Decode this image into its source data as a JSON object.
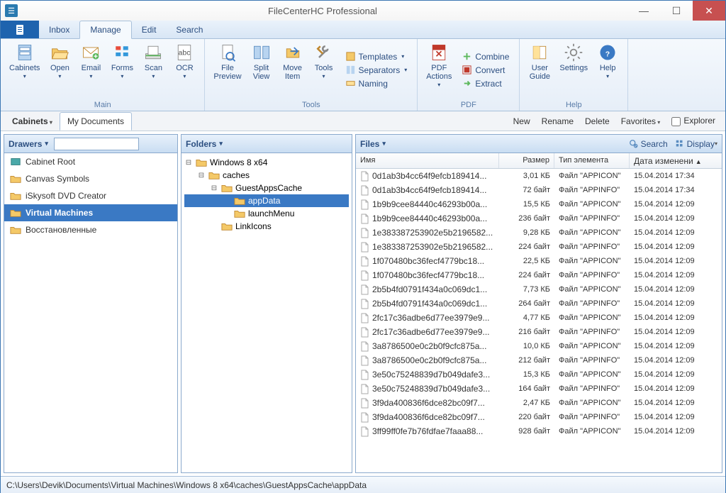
{
  "title": "FileCenterHC Professional",
  "tabs": {
    "inbox": "Inbox",
    "manage": "Manage",
    "edit": "Edit",
    "search": "Search"
  },
  "ribbon": {
    "main": {
      "label": "Main",
      "cabinets": "Cabinets",
      "open": "Open",
      "email": "Email",
      "forms": "Forms",
      "scan": "Scan",
      "ocr": "OCR"
    },
    "tools": {
      "label": "Tools",
      "filePreview": "File\nPreview",
      "splitView": "Split\nView",
      "moveItem": "Move\nItem",
      "tools": "Tools",
      "templates": "Templates",
      "separators": "Separators",
      "naming": "Naming"
    },
    "pdf": {
      "label": "PDF",
      "pdfActions": "PDF\nActions",
      "combine": "Combine",
      "convert": "Convert",
      "extract": "Extract"
    },
    "help": {
      "label": "Help",
      "userGuide": "User\nGuide",
      "settings": "Settings",
      "help": "Help"
    }
  },
  "cabbar": {
    "cabinets": "Cabinets",
    "mydocs": "My Documents",
    "new": "New",
    "rename": "Rename",
    "delete": "Delete",
    "favorites": "Favorites",
    "explorer": "Explorer"
  },
  "drawers": {
    "header": "Drawers",
    "items": [
      {
        "label": "Cabinet Root",
        "type": "folder-teal"
      },
      {
        "label": "Canvas Symbols",
        "type": "folder"
      },
      {
        "label": "iSkysoft DVD Creator",
        "type": "folder"
      },
      {
        "label": "Virtual Machines",
        "type": "folder",
        "sel": true
      },
      {
        "label": "Восстановленные",
        "type": "folder"
      }
    ]
  },
  "folders": {
    "header": "Folders",
    "tree": [
      {
        "depth": 0,
        "tog": "-",
        "label": "Windows 8 x64"
      },
      {
        "depth": 1,
        "tog": "-",
        "label": "caches"
      },
      {
        "depth": 2,
        "tog": "-",
        "label": "GuestAppsCache"
      },
      {
        "depth": 3,
        "tog": "",
        "label": "appData",
        "sel": true
      },
      {
        "depth": 3,
        "tog": "",
        "label": "launchMenu"
      },
      {
        "depth": 2,
        "tog": "",
        "label": "LinkIcons"
      }
    ]
  },
  "files": {
    "header": "Files",
    "search": "Search",
    "display": "Display",
    "cols": {
      "name": "Имя",
      "size": "Размер",
      "type": "Тип элемента",
      "date": "Дата изменени"
    },
    "rows": [
      {
        "name": "0d1ab3b4cc64f9efcb189414...",
        "size": "3,01 КБ",
        "type": "Файл \"APPICON\"",
        "date": "15.04.2014 17:34"
      },
      {
        "name": "0d1ab3b4cc64f9efcb189414...",
        "size": "72 байт",
        "type": "Файл \"APPINFO\"",
        "date": "15.04.2014 17:34"
      },
      {
        "name": "1b9b9cee84440c46293b00a...",
        "size": "15,5 КБ",
        "type": "Файл \"APPICON\"",
        "date": "15.04.2014 12:09"
      },
      {
        "name": "1b9b9cee84440c46293b00a...",
        "size": "236 байт",
        "type": "Файл \"APPINFO\"",
        "date": "15.04.2014 12:09"
      },
      {
        "name": "1e383387253902e5b2196582...",
        "size": "9,28 КБ",
        "type": "Файл \"APPICON\"",
        "date": "15.04.2014 12:09"
      },
      {
        "name": "1e383387253902e5b2196582...",
        "size": "224 байт",
        "type": "Файл \"APPINFO\"",
        "date": "15.04.2014 12:09"
      },
      {
        "name": "1f070480bc36fecf4779bc18...",
        "size": "22,5 КБ",
        "type": "Файл \"APPICON\"",
        "date": "15.04.2014 12:09"
      },
      {
        "name": "1f070480bc36fecf4779bc18...",
        "size": "224 байт",
        "type": "Файл \"APPINFO\"",
        "date": "15.04.2014 12:09"
      },
      {
        "name": "2b5b4fd0791f434a0c069dc1...",
        "size": "7,73 КБ",
        "type": "Файл \"APPICON\"",
        "date": "15.04.2014 12:09"
      },
      {
        "name": "2b5b4fd0791f434a0c069dc1...",
        "size": "264 байт",
        "type": "Файл \"APPINFO\"",
        "date": "15.04.2014 12:09"
      },
      {
        "name": "2fc17c36adbe6d77ee3979e9...",
        "size": "4,77 КБ",
        "type": "Файл \"APPICON\"",
        "date": "15.04.2014 12:09"
      },
      {
        "name": "2fc17c36adbe6d77ee3979e9...",
        "size": "216 байт",
        "type": "Файл \"APPINFO\"",
        "date": "15.04.2014 12:09"
      },
      {
        "name": "3a8786500e0c2b0f9cfc875a...",
        "size": "10,0 КБ",
        "type": "Файл \"APPICON\"",
        "date": "15.04.2014 12:09"
      },
      {
        "name": "3a8786500e0c2b0f9cfc875a...",
        "size": "212 байт",
        "type": "Файл \"APPINFO\"",
        "date": "15.04.2014 12:09"
      },
      {
        "name": "3e50c75248839d7b049dafe3...",
        "size": "15,3 КБ",
        "type": "Файл \"APPICON\"",
        "date": "15.04.2014 12:09"
      },
      {
        "name": "3e50c75248839d7b049dafe3...",
        "size": "164 байт",
        "type": "Файл \"APPINFO\"",
        "date": "15.04.2014 12:09"
      },
      {
        "name": "3f9da400836f6dce82bc09f7...",
        "size": "2,47 КБ",
        "type": "Файл \"APPICON\"",
        "date": "15.04.2014 12:09"
      },
      {
        "name": "3f9da400836f6dce82bc09f7...",
        "size": "220 байт",
        "type": "Файл \"APPINFO\"",
        "date": "15.04.2014 12:09"
      },
      {
        "name": "3ff99ff0fe7b76fdfae7faaa88...",
        "size": "928 байт",
        "type": "Файл \"APPICON\"",
        "date": "15.04.2014 12:09"
      }
    ]
  },
  "status": "C:\\Users\\Devik\\Documents\\Virtual Machines\\Windows 8 x64\\caches\\GuestAppsCache\\appData"
}
